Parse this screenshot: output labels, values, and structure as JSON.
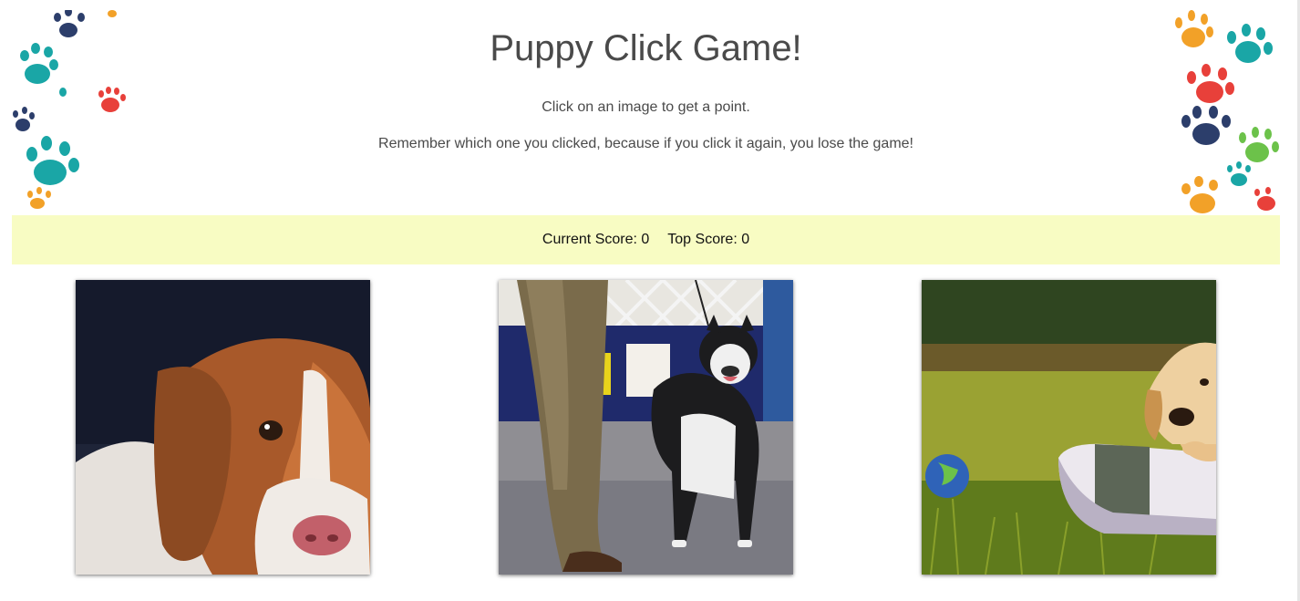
{
  "header": {
    "title": "Puppy Click Game!",
    "instruction": "Click on an image to get a point.",
    "warning": "Remember which one you clicked, because if you click it again, you lose the game!"
  },
  "score": {
    "current_label": "Current Score: 0",
    "top_label": "Top Score: 0"
  },
  "cards": [
    {
      "subject": "beagle puppy"
    },
    {
      "subject": "husky on leash"
    },
    {
      "subject": "golden puppy on grass"
    }
  ],
  "colors": {
    "scorebar_bg": "#f8fcc3",
    "text": "#4a4a4a",
    "paw_teal": "#1aa6a6",
    "paw_navy": "#2c3e6b",
    "paw_red": "#e8403a",
    "paw_orange": "#f2a128",
    "paw_green": "#6cc24a"
  }
}
